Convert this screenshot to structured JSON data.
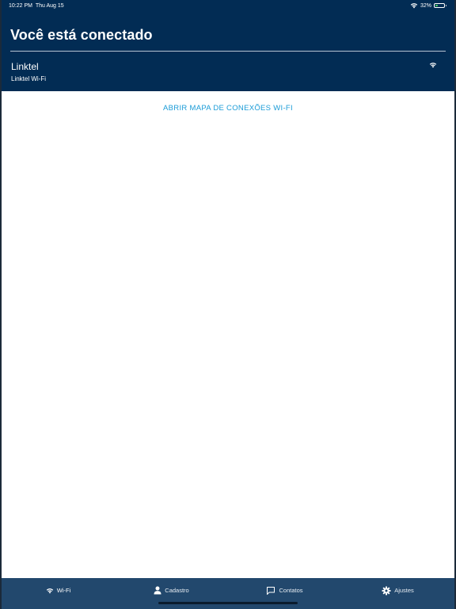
{
  "status_bar": {
    "time": "10:22 PM",
    "date": "Thu Aug 15",
    "battery_percent": "32%",
    "battery_level": 0.32,
    "wifi_icon": "wifi-icon",
    "battery_icon": "battery-icon"
  },
  "header": {
    "title": "Você está conectado",
    "network_name": "Linktel",
    "network_subtitle": "Linktel Wi-Fi",
    "network_icon": "wifi-icon"
  },
  "main": {
    "map_link": "ABRIR MAPA DE CONEXÕES WI-FI"
  },
  "tabbar": {
    "tabs": [
      {
        "label": "Wi-Fi",
        "icon": "wifi-icon"
      },
      {
        "label": "Cadastro",
        "icon": "person-icon"
      },
      {
        "label": "Contatos",
        "icon": "chat-bubble-icon"
      },
      {
        "label": "Ajustes",
        "icon": "gear-icon"
      }
    ]
  },
  "colors": {
    "header_bg": "#022c54",
    "tabbar_bg": "#22486d",
    "link": "#1a9bd7",
    "battery_fill": "#4cd964"
  }
}
